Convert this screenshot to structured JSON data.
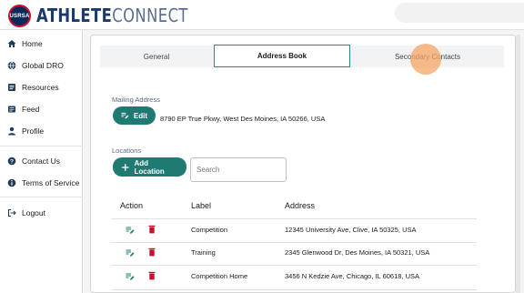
{
  "app": {
    "logo_text": "USRSA",
    "brand_athlete": "ATHLETE",
    "brand_connect": "CONNECT"
  },
  "sidebar": {
    "items": [
      {
        "label": "Home",
        "icon": "home-icon"
      },
      {
        "label": "Global DRO",
        "icon": "globe-icon"
      },
      {
        "label": "Resources",
        "icon": "resources-icon"
      },
      {
        "label": "Feed",
        "icon": "feed-icon"
      },
      {
        "label": "Profile",
        "icon": "person-icon"
      },
      {
        "label": "Contact Us",
        "icon": "help-icon"
      },
      {
        "label": "Terms of Service",
        "icon": "info-icon"
      },
      {
        "label": "Logout",
        "icon": "logout-icon"
      }
    ]
  },
  "tabs": [
    {
      "label": "General",
      "active": false
    },
    {
      "label": "Address Book",
      "active": true
    },
    {
      "label": "Secondary Contacts",
      "active": false
    }
  ],
  "mailing": {
    "section_label": "Mailing Address",
    "edit_label": "Edit",
    "address": "8790 EP True Pkwy, West Des Moines, IA 50266, USA"
  },
  "locations": {
    "section_label": "Locations",
    "add_label": "Add Location",
    "search_placeholder": "Search"
  },
  "table": {
    "headers": {
      "action": "Action",
      "label": "Label",
      "address": "Address"
    },
    "rows": [
      {
        "label": "Competition",
        "address": "12345 University Ave, Clive, IA 50325, USA"
      },
      {
        "label": "Training",
        "address": "2345 Glenwood Dr, Des Moines, IA 50321, USA"
      },
      {
        "label": "Competition Home",
        "address": "3456 N Kedzie Ave, Chicago, IL 60618, USA"
      }
    ]
  },
  "colors": {
    "accent": "#1f7a73",
    "delete": "#c8102e",
    "brand_navy": "#1b3a6b"
  }
}
